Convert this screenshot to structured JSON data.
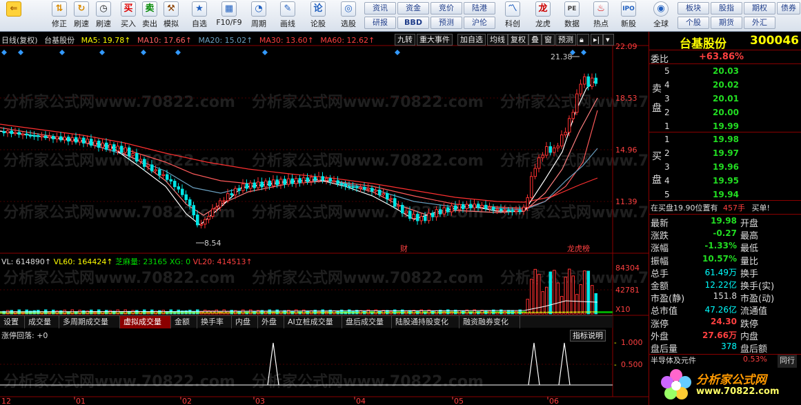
{
  "toolbar": {
    "buttons": [
      {
        "icon": "back-icon",
        "label": ""
      },
      {
        "icon": "up-down-icon",
        "label": "修正"
      },
      {
        "icon": "refresh-icon",
        "label": "刷速"
      },
      {
        "icon": "buy-icon",
        "label": "买入"
      },
      {
        "icon": "sell-icon",
        "label": "卖出"
      },
      {
        "icon": "hammer-icon",
        "label": "模拟"
      },
      {
        "icon": "star-icon",
        "label": "自选"
      },
      {
        "icon": "table-icon",
        "label": "F10/F9"
      },
      {
        "icon": "clock-icon",
        "label": "周期"
      },
      {
        "icon": "pen-icon",
        "label": "画线"
      },
      {
        "icon": "discuss-icon",
        "label": "论股"
      },
      {
        "icon": "select-icon",
        "label": "选股"
      }
    ],
    "grid_buttons": [
      [
        "资讯",
        "资金",
        "竞价",
        "陆港"
      ],
      [
        "研报",
        "BBD",
        "预测",
        "沪伦"
      ]
    ],
    "right_buttons": [
      {
        "icon": "science-icon",
        "label": "科创"
      },
      {
        "icon": "dragon-icon",
        "label": "龙虎"
      },
      {
        "icon": "data-icon",
        "label": "数据"
      },
      {
        "icon": "hot-icon",
        "label": "热点"
      },
      {
        "icon": "new-icon",
        "label": "新股"
      },
      {
        "icon": "globe-icon",
        "label": "全球"
      }
    ],
    "small_grid": [
      [
        "板块",
        "股指",
        "期权",
        "债券"
      ],
      [
        "个股",
        "期货",
        "外汇",
        ""
      ]
    ]
  },
  "chart": {
    "header": {
      "name": "日线(复权)",
      "stock": "台基股份",
      "ma5": "MA5: 19.78↑",
      "ma10": "MA10: 17.66↑",
      "ma20": "MA20: 15.02↑",
      "ma30": "MA30: 13.60↑",
      "ma60": "MA60: 12.62↑"
    },
    "top_buttons": [
      "九转",
      "重大事件",
      "加自选",
      "均线",
      "复权",
      "叠",
      "窗",
      "预测"
    ],
    "price_axis": [
      "22.09",
      "18.53",
      "14.96",
      "11.39"
    ],
    "volume_axis": [
      "84304",
      "42781",
      "X10"
    ],
    "indicator_axis": [
      "1.000",
      "0.500"
    ],
    "annotations": {
      "high": "21.38",
      "low": "8.54",
      "marker1": "财",
      "marker2": "龙虎榜"
    },
    "volume_header": {
      "vl": "VL: 614890↑",
      "vl60": "VL60: 164424↑",
      "zm": "芝麻量: 23165 XG: 0",
      "vl20": "VL20: 414513↑"
    },
    "tabs": [
      "设置",
      "成交量",
      "多周期成交量",
      "虚拟成交量",
      "金额",
      "换手率",
      "内盘",
      "外盘",
      "AI立桩成交量",
      "盘后成交量",
      "陆股通持股变化",
      "融资融券变化"
    ],
    "active_tab": "虚拟成交量",
    "indicator_name": "涨停回落: +0",
    "indicator_button": "指标说明",
    "months": [
      "12",
      "01",
      "02",
      "03",
      "04",
      "05",
      "06"
    ],
    "watermark": "分析家公式网www.70822.com"
  },
  "quote": {
    "title": "台基股份",
    "code": "300046",
    "weibi_label": "委比",
    "weibi": "+63.86%",
    "sell_label_1": "卖",
    "sell_label_2": "盘",
    "buy_label_1": "买",
    "buy_label_2": "盘",
    "sell": [
      [
        "5",
        "20.03"
      ],
      [
        "4",
        "20.02"
      ],
      [
        "3",
        "20.01"
      ],
      [
        "2",
        "20.00"
      ],
      [
        "1",
        "19.99"
      ]
    ],
    "buy": [
      [
        "1",
        "19.98"
      ],
      [
        "2",
        "19.97"
      ],
      [
        "3",
        "19.96"
      ],
      [
        "4",
        "19.95"
      ],
      [
        "5",
        "19.94"
      ]
    ],
    "buy_note": "在买盘19.90位置有",
    "buy_note_qty": "457手",
    "buy_note_tail": "买单!",
    "stats": [
      [
        "最新",
        "19.98",
        "开盘",
        ""
      ],
      [
        "涨跌",
        "-0.27",
        "最高",
        ""
      ],
      [
        "涨幅",
        "-1.33%",
        "最低",
        ""
      ],
      [
        "振幅",
        "10.57%",
        "量比",
        ""
      ],
      [
        "总手",
        "61.49万",
        "换手",
        ""
      ],
      [
        "金额",
        "12.22亿",
        "换手(实)",
        ""
      ],
      [
        "市盈(静)",
        "151.8",
        "市盈(动)",
        ""
      ],
      [
        "总市值",
        "47.26亿",
        "流通值",
        ""
      ],
      [
        "涨停",
        "24.30",
        "跌停",
        ""
      ],
      [
        "外盘",
        "27.66万",
        "内盘",
        ""
      ],
      [
        "盘后量",
        "378",
        "盘后额",
        ""
      ]
    ],
    "sector_name": "半导体及元件",
    "sector_pct": "0.53%",
    "sector_btn": "同行",
    "logo_text": "分析家公式网",
    "logo_url": "www.70822.com"
  }
}
